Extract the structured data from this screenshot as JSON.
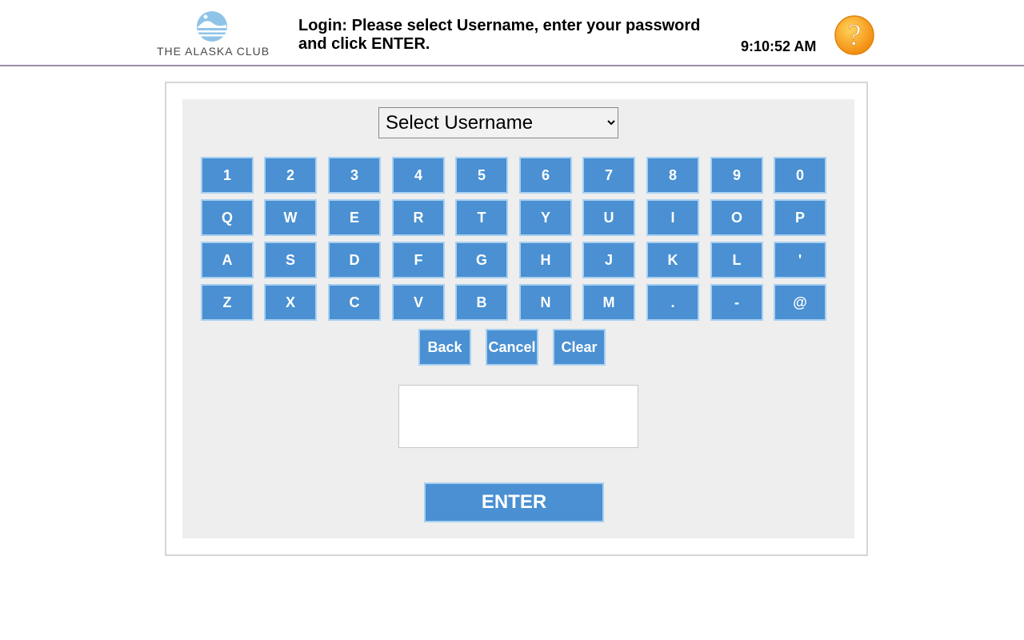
{
  "header": {
    "logo_text": "THE ALASKA CLUB",
    "instruction": "Login: Please select Username, enter your password and click ENTER.",
    "time": "9:10:52 AM",
    "help_icon": "question-mark-icon"
  },
  "form": {
    "username_select": {
      "selected": "Select Username",
      "options": [
        "Select Username"
      ]
    },
    "password_value": "",
    "enter_label": "ENTER"
  },
  "keyboard": {
    "rows": [
      [
        "1",
        "2",
        "3",
        "4",
        "5",
        "6",
        "7",
        "8",
        "9",
        "0"
      ],
      [
        "Q",
        "W",
        "E",
        "R",
        "T",
        "Y",
        "U",
        "I",
        "O",
        "P"
      ],
      [
        "A",
        "S",
        "D",
        "F",
        "G",
        "H",
        "J",
        "K",
        "L",
        "'"
      ],
      [
        "Z",
        "X",
        "C",
        "V",
        "B",
        "N",
        "M",
        ".",
        "-",
        "@"
      ]
    ],
    "controls": [
      "Back",
      "Cancel",
      "Clear"
    ]
  },
  "colors": {
    "key_bg": "#4a90d2",
    "key_border": "#a8d0f2",
    "panel_bg": "#eeeeee",
    "header_rule": "#9c8aa8",
    "help_icon": "#f7a21b"
  }
}
